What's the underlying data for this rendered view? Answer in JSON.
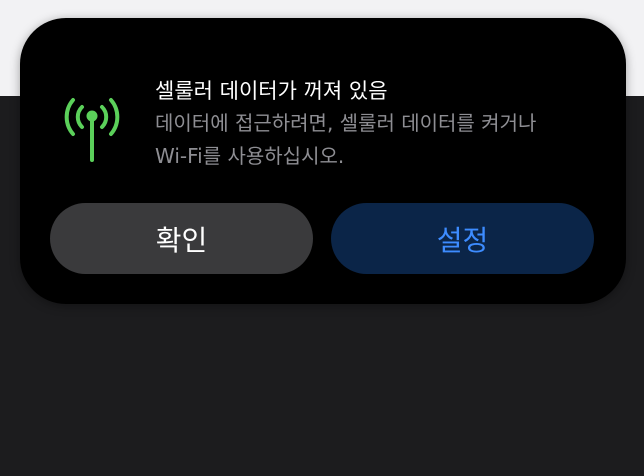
{
  "dialog": {
    "title": "셀룰러 데이터가 꺼져 있음",
    "message": "데이터에 접근하려면, 셀룰러 데이터를 켜거나\nWi-Fi를 사용하십시오.",
    "icon": "cellular-antenna-icon",
    "icon_color": "#5bd05a"
  },
  "buttons": {
    "ok_label": "확인",
    "settings_label": "설정",
    "ok_bg": "#3a3a3c",
    "settings_bg": "#0b2548",
    "settings_text": "#3d8cff"
  }
}
